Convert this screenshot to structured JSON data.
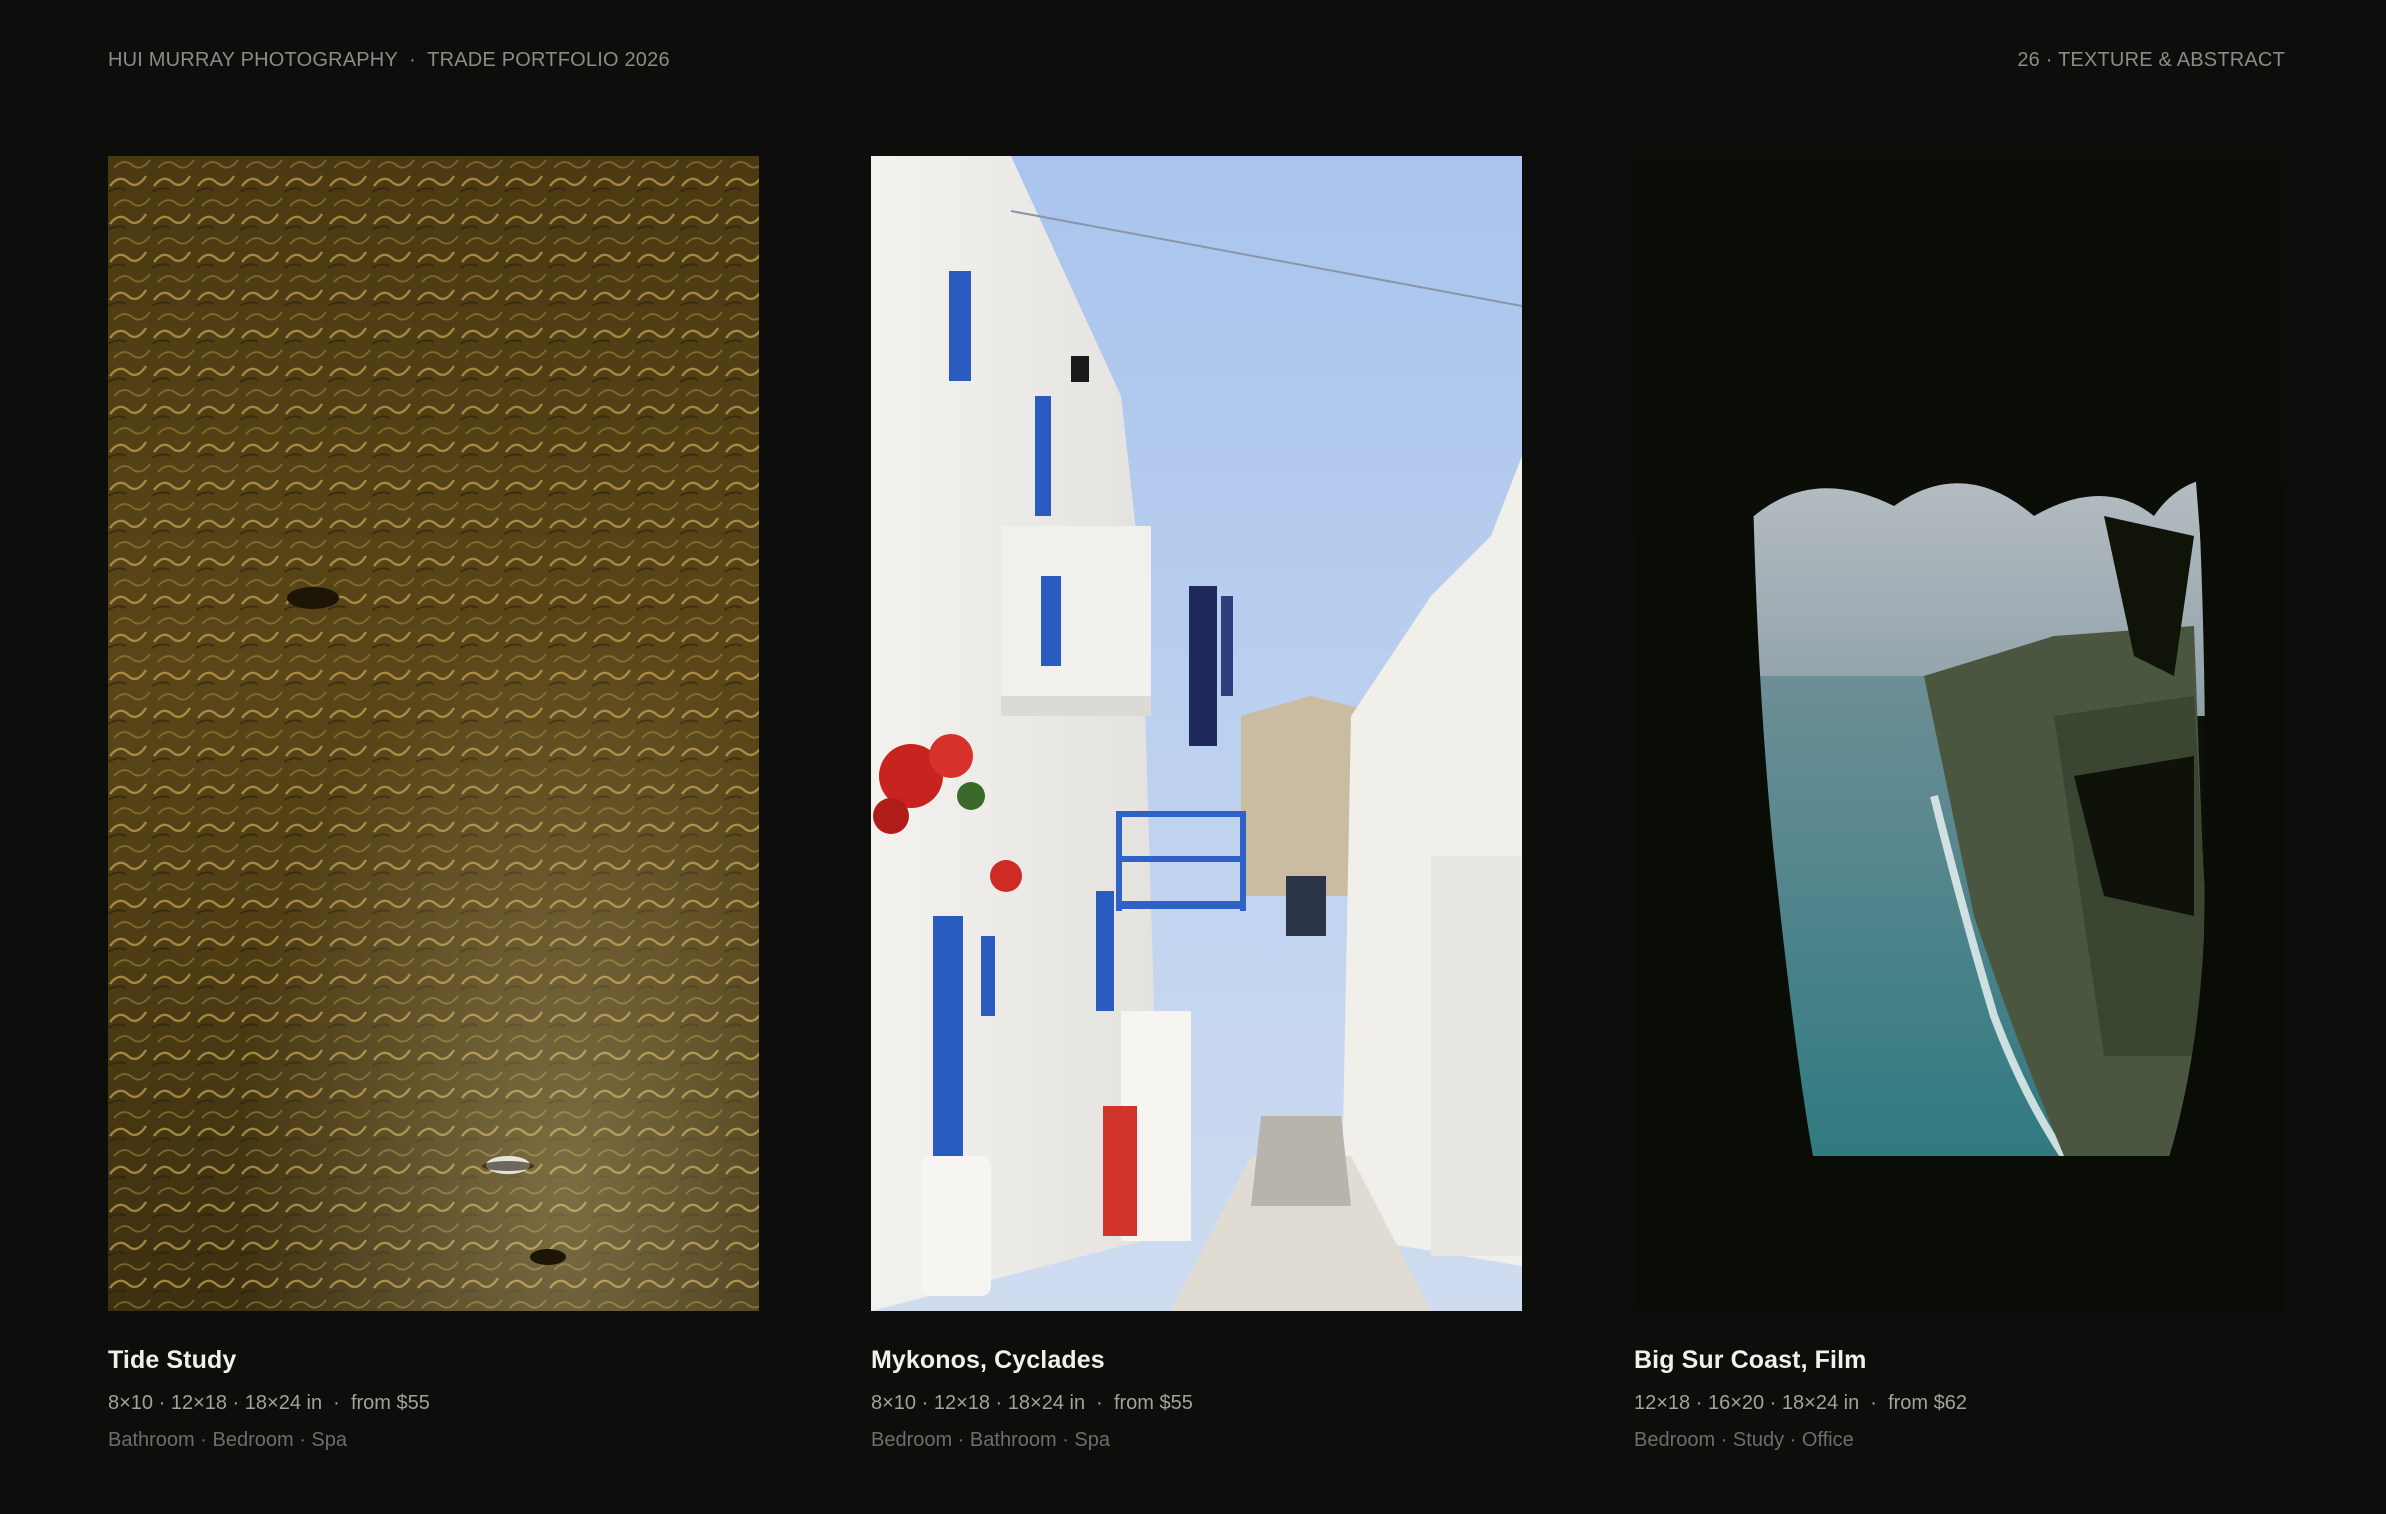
{
  "header": {
    "studio": "HUI MURRAY PHOTOGRAPHY",
    "separator": "  ·  ",
    "portfolio": "TRADE PORTFOLIO 2026",
    "section": "26 · TEXTURE & ABSTRACT"
  },
  "photos": [
    {
      "title": "Tide Study",
      "sizes": "8×10 · 12×18 · 18×24 in",
      "price": "from $55",
      "rooms": "Bathroom · Bedroom · Spa",
      "image_desc": "golden-water-ripples-photo"
    },
    {
      "title": "Mykonos, Cyclades",
      "sizes": "8×10 · 12×18 · 18×24 in",
      "price": "from $55",
      "rooms": "Bedroom · Bathroom · Spa",
      "image_desc": "white-alley-blue-shutters-photo"
    },
    {
      "title": "Big Sur Coast, Film",
      "sizes": "12×18 · 16×20 · 18×24 in",
      "price": "from $62",
      "rooms": "Bedroom · Study · Office",
      "image_desc": "coast-through-trees-photo"
    }
  ],
  "specs_separator": "  ·  ",
  "colors": {
    "background": "#0d0d0b",
    "title": "#f2f0ea",
    "specs": "#a3a19a",
    "rooms": "#6f6d68",
    "header": "#8d8b86"
  }
}
